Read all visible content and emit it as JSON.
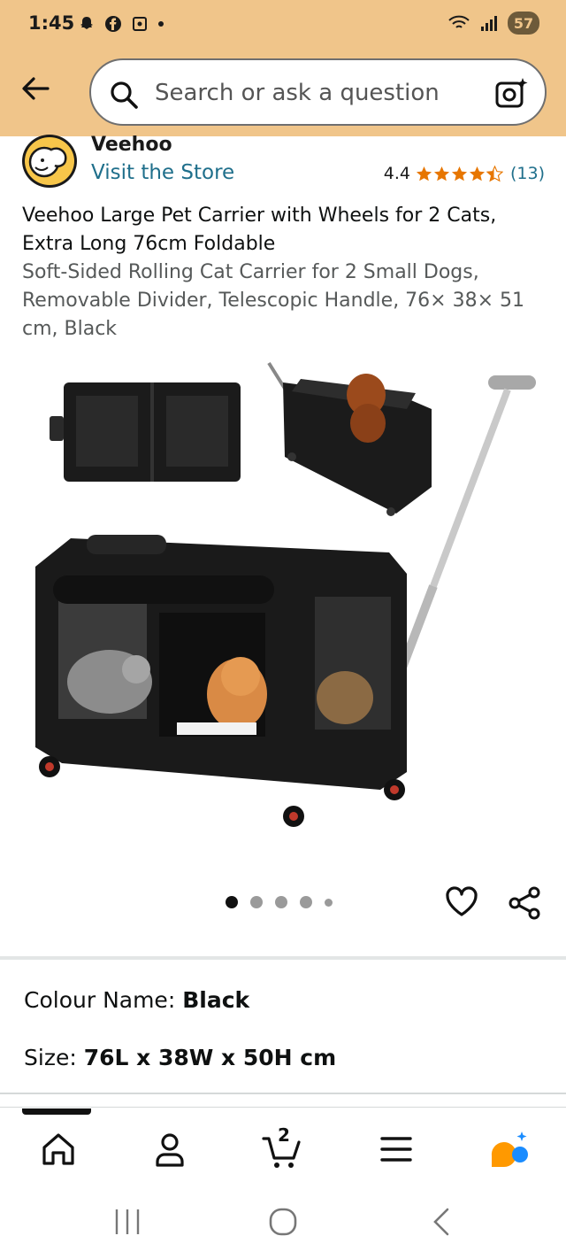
{
  "status_bar": {
    "time": "1:45",
    "battery": "57"
  },
  "search": {
    "placeholder": "Search or ask a question"
  },
  "brand": {
    "name": "Veehoo",
    "visit_link": "Visit the Store",
    "rating": "4.4",
    "stars": 4.4,
    "review_count": "(13)"
  },
  "product": {
    "title": "Veehoo Large Pet Carrier with Wheels for 2 Cats, Extra Long 76cm Foldable",
    "subtitle": "Soft-Sided Rolling Cat Carrier for 2 Small Dogs, Removable Divider, Telescopic Handle, 76× 38× 51 cm, Black"
  },
  "gallery": {
    "image_count": 5,
    "active_index": 0
  },
  "variants": {
    "colour_label": "Colour Name:",
    "colour_value": "Black",
    "size_label": "Size:",
    "size_value": "76L x 38W x 50H cm"
  },
  "bottom_nav": {
    "cart_count": "2"
  },
  "colors": {
    "header_bg": "#f0c58a",
    "link": "#1f6f8b",
    "star": "#e77600",
    "accent_orange": "#ff9900",
    "accent_blue": "#1a8cff"
  }
}
